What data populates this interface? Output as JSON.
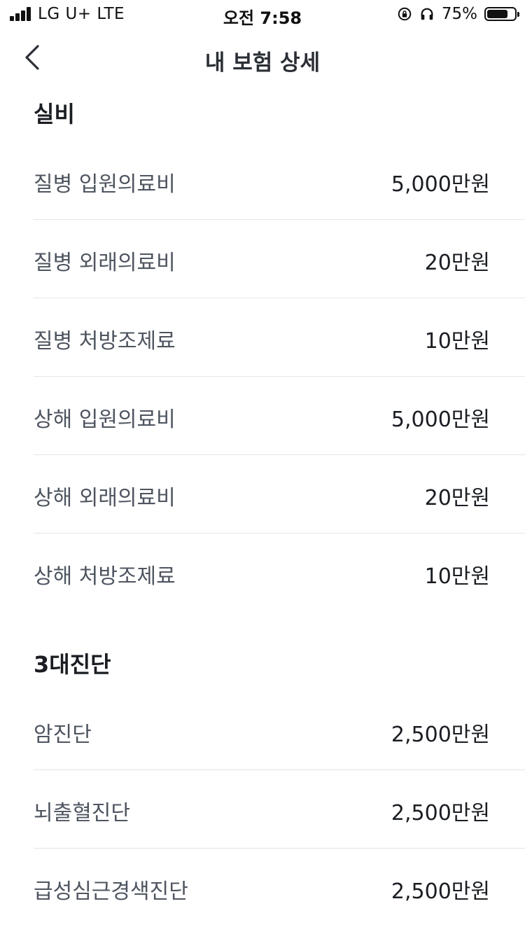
{
  "status_bar": {
    "carrier": "LG U+  LTE",
    "time": "오전 7:58",
    "battery_percent": "75%",
    "battery_level": 0.75
  },
  "nav": {
    "title": "내 보험 상세"
  },
  "sections": [
    {
      "title": "실비",
      "rows": [
        {
          "label": "질병 입원의료비",
          "value": "5,000만원"
        },
        {
          "label": "질병 외래의료비",
          "value": "20만원"
        },
        {
          "label": "질병 처방조제료",
          "value": "10만원"
        },
        {
          "label": "상해 입원의료비",
          "value": "5,000만원"
        },
        {
          "label": "상해 외래의료비",
          "value": "20만원"
        },
        {
          "label": "상해 처방조제료",
          "value": "10만원"
        }
      ]
    },
    {
      "title": "3대진단",
      "rows": [
        {
          "label": "암진단",
          "value": "2,500만원"
        },
        {
          "label": "뇌출혈진단",
          "value": "2,500만원"
        },
        {
          "label": "급성심근경색진단",
          "value": "2,500만원"
        }
      ]
    }
  ]
}
